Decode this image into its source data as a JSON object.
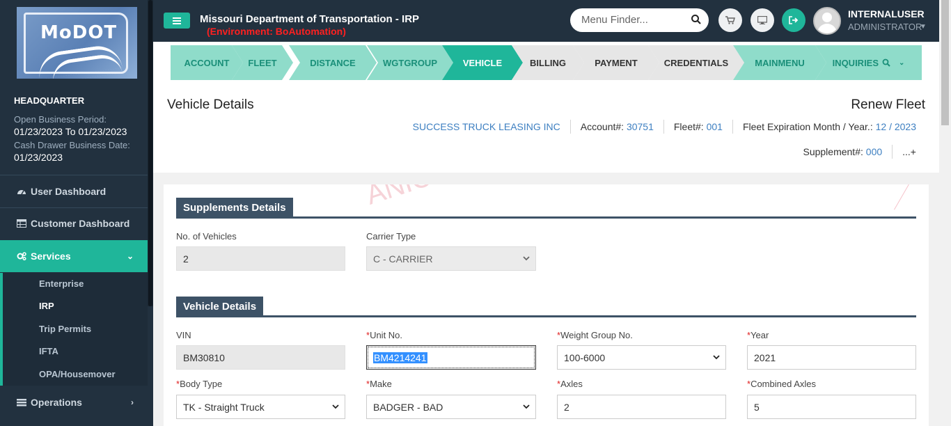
{
  "sidebar": {
    "logo_text": "MoDOT",
    "location": "HEADQUARTER",
    "open_business_period_label": "Open Business Period:",
    "open_business_period_value": "01/23/2023 To 01/23/2023",
    "cash_drawer_label": "Cash Drawer Business Date:",
    "cash_drawer_value": "01/23/2023",
    "nav": [
      {
        "label": "User Dashboard",
        "icon": "dashboard-icon"
      },
      {
        "label": "Customer Dashboard",
        "icon": "table-icon"
      },
      {
        "label": "Services",
        "icon": "gears-icon",
        "active": true
      },
      {
        "label": "Operations",
        "icon": "list-icon"
      }
    ],
    "services_sub": [
      "Enterprise",
      "IRP",
      "Trip Permits",
      "IFTA",
      "OPA/Housemover"
    ],
    "active_sub": "IRP",
    "accent": "#1fb69a"
  },
  "header": {
    "title": "Missouri Department of Transportation - IRP",
    "environment": "(Environment: BoAutomation)",
    "menu_finder_placeholder": "Menu Finder...",
    "user_name": "INTERNALUSER",
    "user_role": "ADMINISTRATOR"
  },
  "wizard": {
    "steps": [
      "ACCOUNT",
      "FLEET",
      "DISTANCE",
      "WGTGROUP",
      "VEHICLE",
      "BILLING",
      "PAYMENT",
      "CREDENTIALS",
      "MAINMENU",
      "INQUIRIES"
    ],
    "current": "VEHICLE"
  },
  "page": {
    "title": "Vehicle Details",
    "action_title": "Renew Fleet",
    "company": "SUCCESS TRUCK LEASING INC",
    "account_label": "Account#:",
    "account_value": "30751",
    "fleet_label": "Fleet#:",
    "fleet_value": "001",
    "expiration_label": "Fleet Expiration Month / Year.:",
    "expiration_value": "12 / 2023",
    "supplement_label": "Supplement#:",
    "supplement_value": "000",
    "more_link": "...+"
  },
  "supplements_section": {
    "title": "Supplements Details",
    "num_vehicles_label": "No. of Vehicles",
    "num_vehicles_value": "2",
    "carrier_type_label": "Carrier Type",
    "carrier_type_value": "C - CARRIER"
  },
  "vehicle_section": {
    "title": "Vehicle Details",
    "vin_label": "VIN",
    "vin_value": "BM30810",
    "unit_label": "Unit No.",
    "unit_value": "BM4214241",
    "weight_group_label": "Weight Group No.",
    "weight_group_value": "100-6000",
    "year_label": "Year",
    "year_value": "2021",
    "body_type_label": "Body Type",
    "body_type_value": "TK - Straight Truck",
    "make_label": "Make",
    "make_value": "BADGER - BAD",
    "axles_label": "Axles",
    "axles_value": "2",
    "combined_axles_label": "Combined Axles",
    "combined_axles_value": "5",
    "required_marker": "*"
  },
  "watermark_text": "ANIC"
}
